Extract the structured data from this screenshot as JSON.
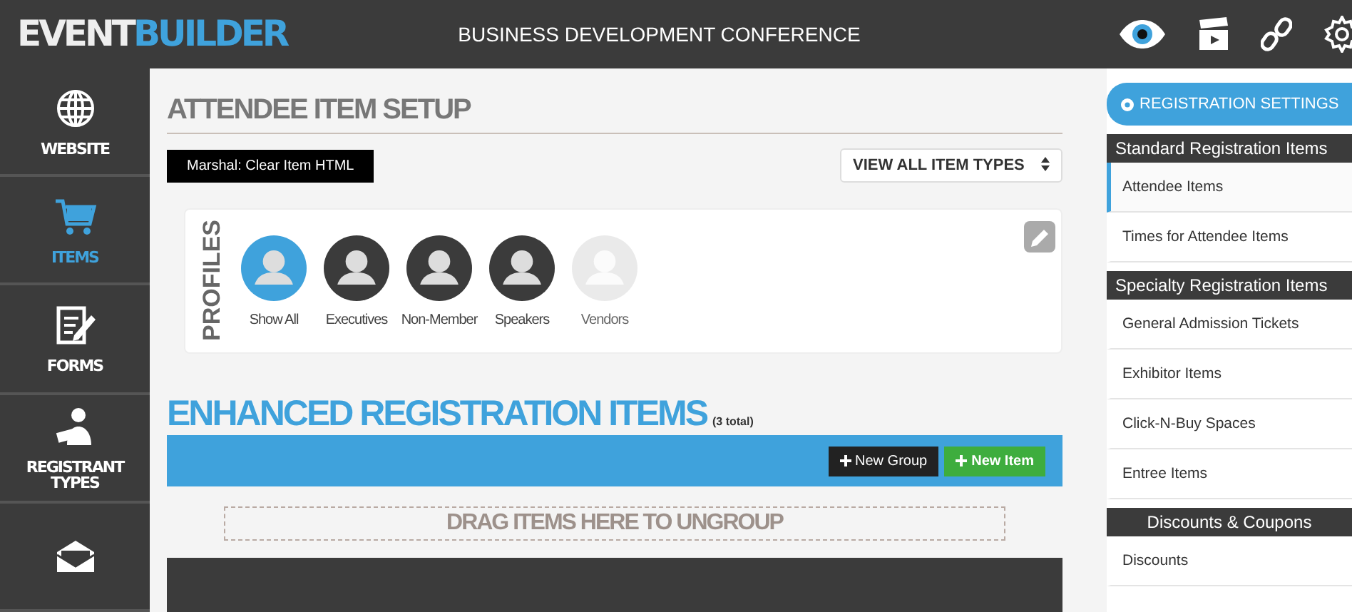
{
  "header": {
    "logo_left": "EVENT",
    "logo_right": "BUILDER",
    "title": "BUSINESS DEVELOPMENT CONFERENCE"
  },
  "sidebar": {
    "items": [
      {
        "label": "WEBSITE",
        "selected": false
      },
      {
        "label": "ITEMS",
        "selected": true
      },
      {
        "label": "FORMS",
        "selected": false
      },
      {
        "label": "REGISTRANT TYPES",
        "selected": false
      },
      {
        "selected": false
      }
    ]
  },
  "main": {
    "heading": "ATTENDEE ITEM SETUP",
    "action_button": "Marshal: Clear Item HTML",
    "type_select": {
      "value": "VIEW ALL ITEM TYPES"
    },
    "profiles": {
      "label": "PROFILES",
      "items": [
        {
          "label": "Show All",
          "selected": true,
          "disabled": false
        },
        {
          "label": "Executives",
          "selected": false,
          "disabled": false
        },
        {
          "label": "Non-Member",
          "selected": false,
          "disabled": false
        },
        {
          "label": "Speakers",
          "selected": false,
          "disabled": false
        },
        {
          "label": "Vendors",
          "selected": false,
          "disabled": true
        }
      ]
    },
    "section": {
      "title": "ENHANCED REGISTRATION ITEMS",
      "count": "(3 total)",
      "buttons": [
        {
          "label": "New Group",
          "kind": "dark"
        },
        {
          "label": "New Item",
          "kind": "green"
        }
      ],
      "drop_zone": "DRAG ITEMS HERE TO UNGROUP"
    }
  },
  "settings": {
    "button": "REGISTRATION SETTINGS",
    "groups": [
      {
        "header": "Standard Registration Items",
        "items": [
          {
            "label": "Attendee Items",
            "selected": true
          },
          {
            "label": "Times for Attendee Items",
            "selected": false
          }
        ]
      },
      {
        "header": "Specialty Registration Items",
        "items": [
          {
            "label": "General Admission Tickets",
            "selected": false
          },
          {
            "label": "Exhibitor Items",
            "selected": false
          },
          {
            "label": "Click-N-Buy Spaces",
            "selected": false
          },
          {
            "label": "Entree Items",
            "selected": false
          }
        ]
      },
      {
        "header": "Discounts & Coupons",
        "items": [
          {
            "label": "Discounts",
            "selected": false
          }
        ]
      }
    ]
  }
}
